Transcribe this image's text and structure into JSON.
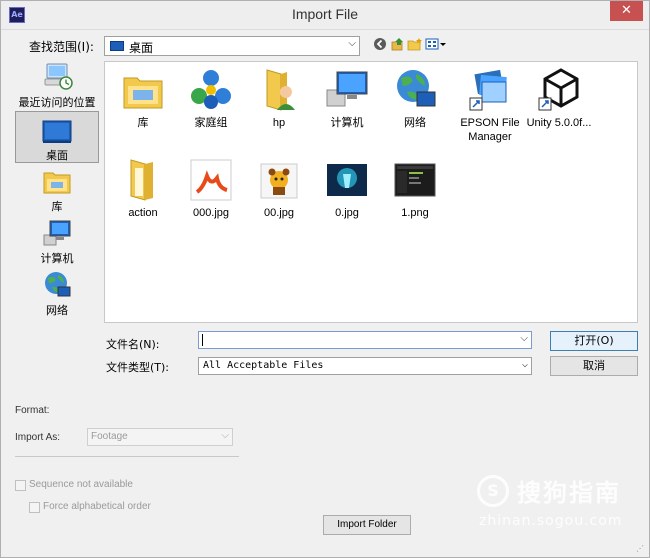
{
  "window": {
    "title": "Import File",
    "close_glyph": "✕",
    "app_icon_text": "Ae"
  },
  "lookin": {
    "label": "查找范围(I):",
    "value": "桌面"
  },
  "places": [
    {
      "label": "最近访问的位置",
      "icon": "recent-places-icon"
    },
    {
      "label": "桌面",
      "icon": "desktop-icon",
      "selected": true
    },
    {
      "label": "库",
      "icon": "library-icon"
    },
    {
      "label": "计算机",
      "icon": "computer-icon"
    },
    {
      "label": "网络",
      "icon": "network-icon"
    }
  ],
  "files": [
    {
      "label": "库",
      "icon": "library-icon"
    },
    {
      "label": "家庭组",
      "icon": "homegroup-icon"
    },
    {
      "label": "hp",
      "icon": "user-folder-icon"
    },
    {
      "label": "计算机",
      "icon": "computer-icon"
    },
    {
      "label": "网络",
      "icon": "network-icon"
    },
    {
      "label": "EPSON File Manager",
      "icon": "epson-shortcut-icon"
    },
    {
      "label": "Unity 5.0.0f...",
      "icon": "unity-shortcut-icon"
    },
    {
      "label": "action",
      "icon": "folder-icon"
    },
    {
      "label": "000.jpg",
      "icon": "image-thumbnail-icon"
    },
    {
      "label": "00.jpg",
      "icon": "image-thumbnail-icon"
    },
    {
      "label": "0.jpg",
      "icon": "image-thumbnail-icon"
    },
    {
      "label": "1.png",
      "icon": "image-thumbnail-icon"
    }
  ],
  "filename": {
    "label": "文件名(N):",
    "value": ""
  },
  "filetype": {
    "label": "文件类型(T):",
    "value": "All Acceptable Files"
  },
  "buttons": {
    "open": "打开(O)",
    "cancel": "取消",
    "import_folder": "Import Folder"
  },
  "options": {
    "format_label": "Format:",
    "import_as_label": "Import As:",
    "import_as_value": "Footage",
    "sequence_label": "Sequence not available",
    "alpha_label": "Force alphabetical order"
  },
  "watermark": {
    "brand": "搜狗指南",
    "url": "zhinan.sogou.com",
    "logo_letter": "S"
  },
  "colors": {
    "close_button": "#c75050",
    "selection": "#d9d9d9",
    "desktop_blue": "#1d5fb8",
    "folder_yellow": "#f2c94c"
  }
}
